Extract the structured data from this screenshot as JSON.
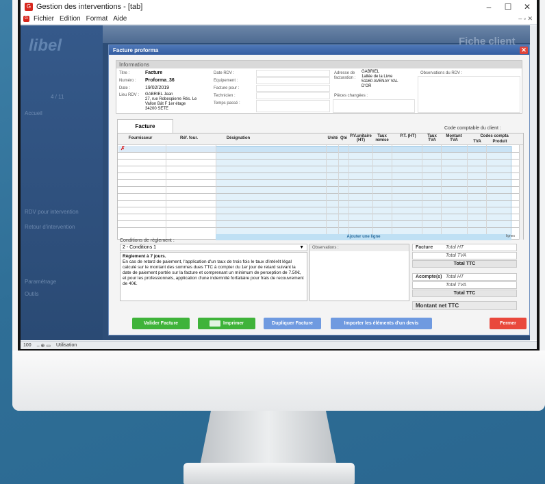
{
  "window": {
    "title": "Gestion des interventions - [tab]",
    "controls": [
      "–",
      "☐",
      "✕"
    ]
  },
  "menu": {
    "items": [
      "Fichier",
      "Edition",
      "Format",
      "Aide"
    ],
    "mdi_controls": "– ▫ ✕"
  },
  "app": {
    "logo": "libel",
    "side_items": [
      "4 / 11",
      "Accueil",
      "RDV pour intervention",
      "Retour d'intervention",
      "Paramétrage",
      "Outils"
    ],
    "header_right": "Fiche client"
  },
  "statusbar": {
    "zoom": "100",
    "mode": "Utilisation"
  },
  "dialog": {
    "title": "Facture proforma",
    "close": "✕",
    "info": {
      "section": "Informations",
      "titre_label": "Titre :",
      "titre_value": "Facture",
      "numero_label": "Numéro :",
      "numero_value": "Proforma_36",
      "date_label": "Date :",
      "date_value": "19/02/2019",
      "lieu_label": "Lieu RDV :",
      "lieu_lines": [
        "GABRIEL Jean",
        "27, rue Robespierre Rés. Le",
        "Vallon Bât F 1er étage",
        "34200 SETE"
      ],
      "date_rdv_label": "Date RDV :",
      "equipement_label": "Equipement :",
      "facture_pour_label": "Facture pour :",
      "technicien_label": "Technicien :",
      "temps_label": "Temps passé :",
      "adresse_label": "Adresse de facturation :",
      "adresse_lines": [
        "GABRIEL",
        "1allée de la Livre",
        "51160 AVENAY VAL",
        "D'OR"
      ],
      "pieces_label": "Pièces changées :",
      "observations_label": "Observations du RDV :"
    },
    "tab": "Facture",
    "code_comptable_label": "Code comptable du client :",
    "grid": {
      "headers": {
        "fournisseur": "Fournisseur",
        "ref": "Réf. four.",
        "designation": "Désignation",
        "unite": "Unité",
        "qte": "Qté",
        "pu": "P.V.unitaire (HT)",
        "remise": "Taux remise",
        "pt": "P.T. (HT)",
        "tva": "Taux TVA",
        "montant_tva": "Montant TVA",
        "codes": "Codes compta",
        "codes_tva": "TVA",
        "codes_produit": "Produit"
      },
      "add_line": "Ajouter une ligne",
      "lignes": "lignes"
    },
    "conditions": {
      "label": "Conditions de règlement :",
      "selected": "2 - Conditions 1",
      "title": "Règlement à 7 jours.",
      "text": "En cas de retard de paiement, l'application d'un taux de trois fois le taux d'intérêt légal calculé sur le montant des sommes dues TTC à compter du 1er jour de retard suivant la date de paiement portée sur la facture et comprenant un minimum de perception de 7.50€, et pour les professionnels, application d'une indemnité forfaitaire pour frais de recouvrement de 40€."
    },
    "observations_label": "Observations :",
    "totals": {
      "facture_label": "Facture",
      "total_ht": "Total HT",
      "total_tva": "Total TVA",
      "total_ttc": "Total TTC",
      "acompte_label": "Acompte(s)",
      "acompte_total_ht": "Total HT",
      "acompte_total_tva": "Total TVA",
      "acompte_total_ttc": "Total TTC",
      "montant_net": "Montant net TTC"
    },
    "buttons": {
      "valider": "Valider Facture",
      "imprimer": "Imprimer",
      "dupliquer": "Dupliquer Facture",
      "importer": "Importer les éléments d'un devis",
      "fermer": "Fermer"
    }
  },
  "colors": {
    "green_button": "#3fb33a",
    "blue_button": "#6f9ae0",
    "red_button": "#e9483c",
    "dialog_title": "#335ca0"
  }
}
